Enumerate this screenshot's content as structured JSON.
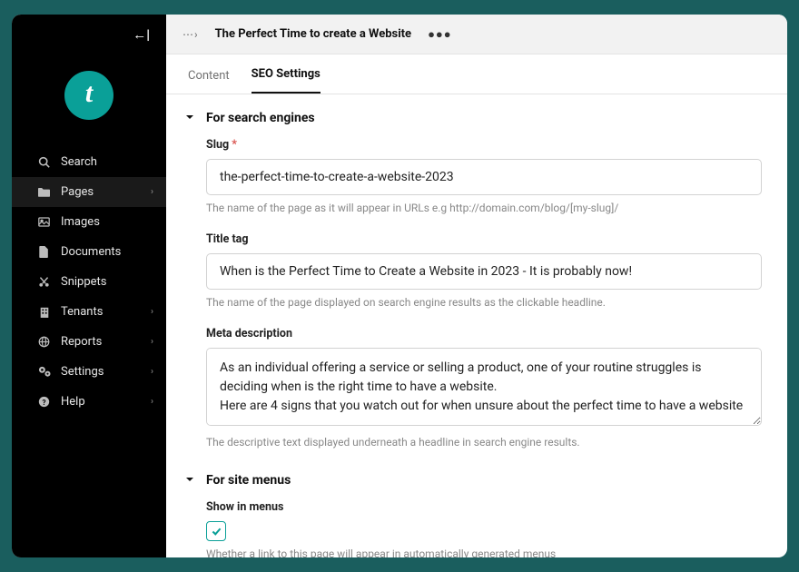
{
  "sidebar": {
    "items": [
      {
        "label": "Search",
        "icon": "search",
        "expandable": false
      },
      {
        "label": "Pages",
        "icon": "folder",
        "expandable": true,
        "active": true
      },
      {
        "label": "Images",
        "icon": "image",
        "expandable": false
      },
      {
        "label": "Documents",
        "icon": "document",
        "expandable": false
      },
      {
        "label": "Snippets",
        "icon": "snippet",
        "expandable": false
      },
      {
        "label": "Tenants",
        "icon": "building",
        "expandable": true
      },
      {
        "label": "Reports",
        "icon": "globe",
        "expandable": true
      },
      {
        "label": "Settings",
        "icon": "gears",
        "expandable": true
      },
      {
        "label": "Help",
        "icon": "help",
        "expandable": true
      }
    ]
  },
  "header": {
    "breadcrumb_ellipsis": "⋯›",
    "title": "The Perfect Time to create a Website",
    "actions_icon": "●●●"
  },
  "tabs": {
    "content": "Content",
    "seo": "SEO Settings"
  },
  "sections": {
    "search_engines": {
      "heading": "For search engines",
      "slug": {
        "label": "Slug",
        "required": "*",
        "value": "the-perfect-time-to-create-a-website-2023",
        "help": "The name of the page as it will appear in URLs e.g http://domain.com/blog/[my-slug]/"
      },
      "title_tag": {
        "label": "Title tag",
        "value": "When is the Perfect Time to Create a Website in 2023 - It is probably now!",
        "help": "The name of the page displayed on search engine results as the clickable headline."
      },
      "meta_description": {
        "label": "Meta description",
        "value": "As an individual offering a service or selling a product, one of your routine struggles is deciding when is the right time to have a website.\nHere are 4 signs that you watch out for when unsure about the perfect time to have a website",
        "help": "The descriptive text displayed underneath a headline in search engine results."
      }
    },
    "site_menus": {
      "heading": "For site menus",
      "show_in_menus": {
        "label": "Show in menus",
        "checked": true,
        "help": "Whether a link to this page will appear in automatically generated menus"
      }
    }
  }
}
